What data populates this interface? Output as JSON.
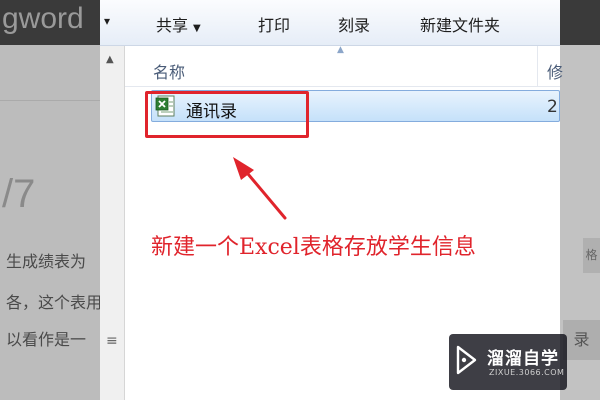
{
  "background_page": {
    "topbar_text": "gword",
    "heading_fragment": "/7",
    "lines": [
      "生成绩表为",
      "各，这个表用",
      "以看作是一"
    ],
    "right_tab_text": "格",
    "right_box_text": "录"
  },
  "toolbar": {
    "share_label": "共享",
    "print_label": "打印",
    "burn_label": "刻录",
    "new_folder_label": "新建文件夹"
  },
  "file_list": {
    "column_name": "名称",
    "column_next_partial": "修",
    "files": [
      {
        "name": "通讯录",
        "next_col_partial": "2",
        "icon": "excel-file-icon"
      }
    ]
  },
  "annotation": {
    "text": "新建一个Excel表格存放学生信息",
    "color": "#e0242c"
  },
  "watermark": {
    "brand": "溜溜自学",
    "url": "ZIXUE.3066.COM"
  },
  "colors": {
    "accent_red": "#e0242c",
    "selection_blue": "#c5e1fa"
  }
}
